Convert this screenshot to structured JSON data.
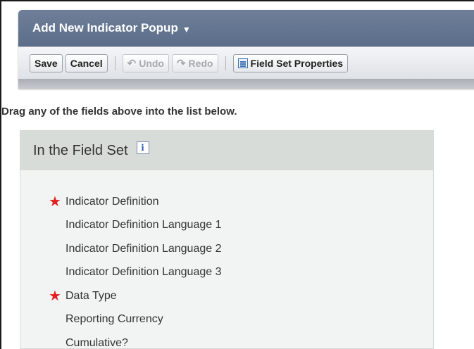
{
  "popup": {
    "title": "Add New Indicator Popup",
    "title_caret_icon": "caret-down-icon"
  },
  "toolbar": {
    "save_label": "Save",
    "cancel_label": "Cancel",
    "undo_label": "Undo",
    "redo_label": "Redo",
    "field_set_properties_label": "Field Set Properties",
    "undo_icon": "undo-icon",
    "redo_icon": "redo-icon",
    "field_set_properties_icon": "list-icon"
  },
  "hint": "Drag any of the fields above into the list below.",
  "field_set": {
    "title": "In the Field Set",
    "info_glyph": "i",
    "fields": [
      {
        "label": "Indicator Definition",
        "required": true
      },
      {
        "label": "Indicator Definition Language 1",
        "required": false
      },
      {
        "label": "Indicator Definition Language 2",
        "required": false
      },
      {
        "label": "Indicator Definition Language 3",
        "required": false
      },
      {
        "label": "Data Type",
        "required": true
      },
      {
        "label": "Reporting Currency",
        "required": false
      },
      {
        "label": "Cumulative?",
        "required": false
      }
    ]
  },
  "colors": {
    "title_bar": "#5b6d8a",
    "required_marker": "#e02020",
    "field_set_header": "#d8dcd9",
    "field_set_body": "#f1f4f2"
  }
}
